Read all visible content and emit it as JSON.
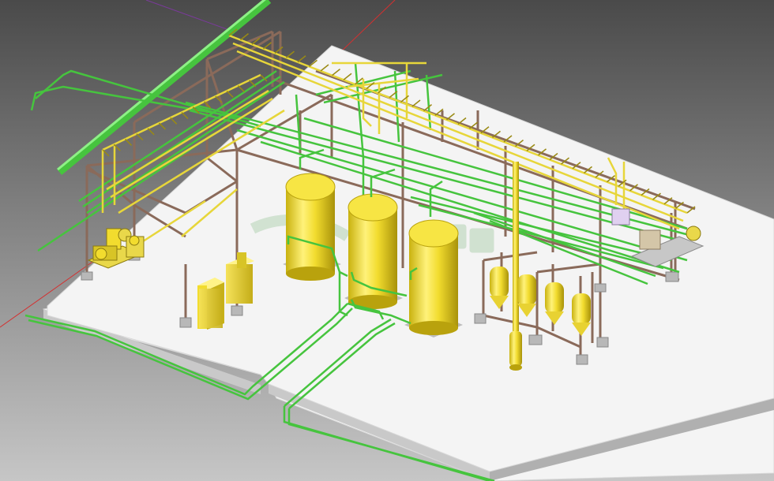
{
  "viewport": {
    "background_top": "#4a4a4a",
    "background_bottom": "#c6c6c6"
  },
  "colors": {
    "slab_top": "#f4f4f4",
    "slab_side_left": "#c9c9c9",
    "slab_side_right": "#b0b0b0",
    "steel": "#8a6a5a",
    "steel_dark": "#5a4238",
    "pipe_green": "#46c43e",
    "pipe_green_dark": "#1f7a1c",
    "pipe_yellow": "#e7d63a",
    "pipe_yellow_dark": "#9a8a14",
    "vessel": "#f2dc2e",
    "vessel_shade": "#b9a20d",
    "pedestal": "#b8b8b8",
    "axis_red": "#d43030",
    "axis_purple": "#7a3a9a"
  },
  "watermark": {
    "visible": true,
    "color": "#8fbf8f",
    "opacity": 0.35
  },
  "equipment": {
    "vessels": 3,
    "small_tanks": 4,
    "electrical_cabinets": 3,
    "pump_skids": 3
  }
}
